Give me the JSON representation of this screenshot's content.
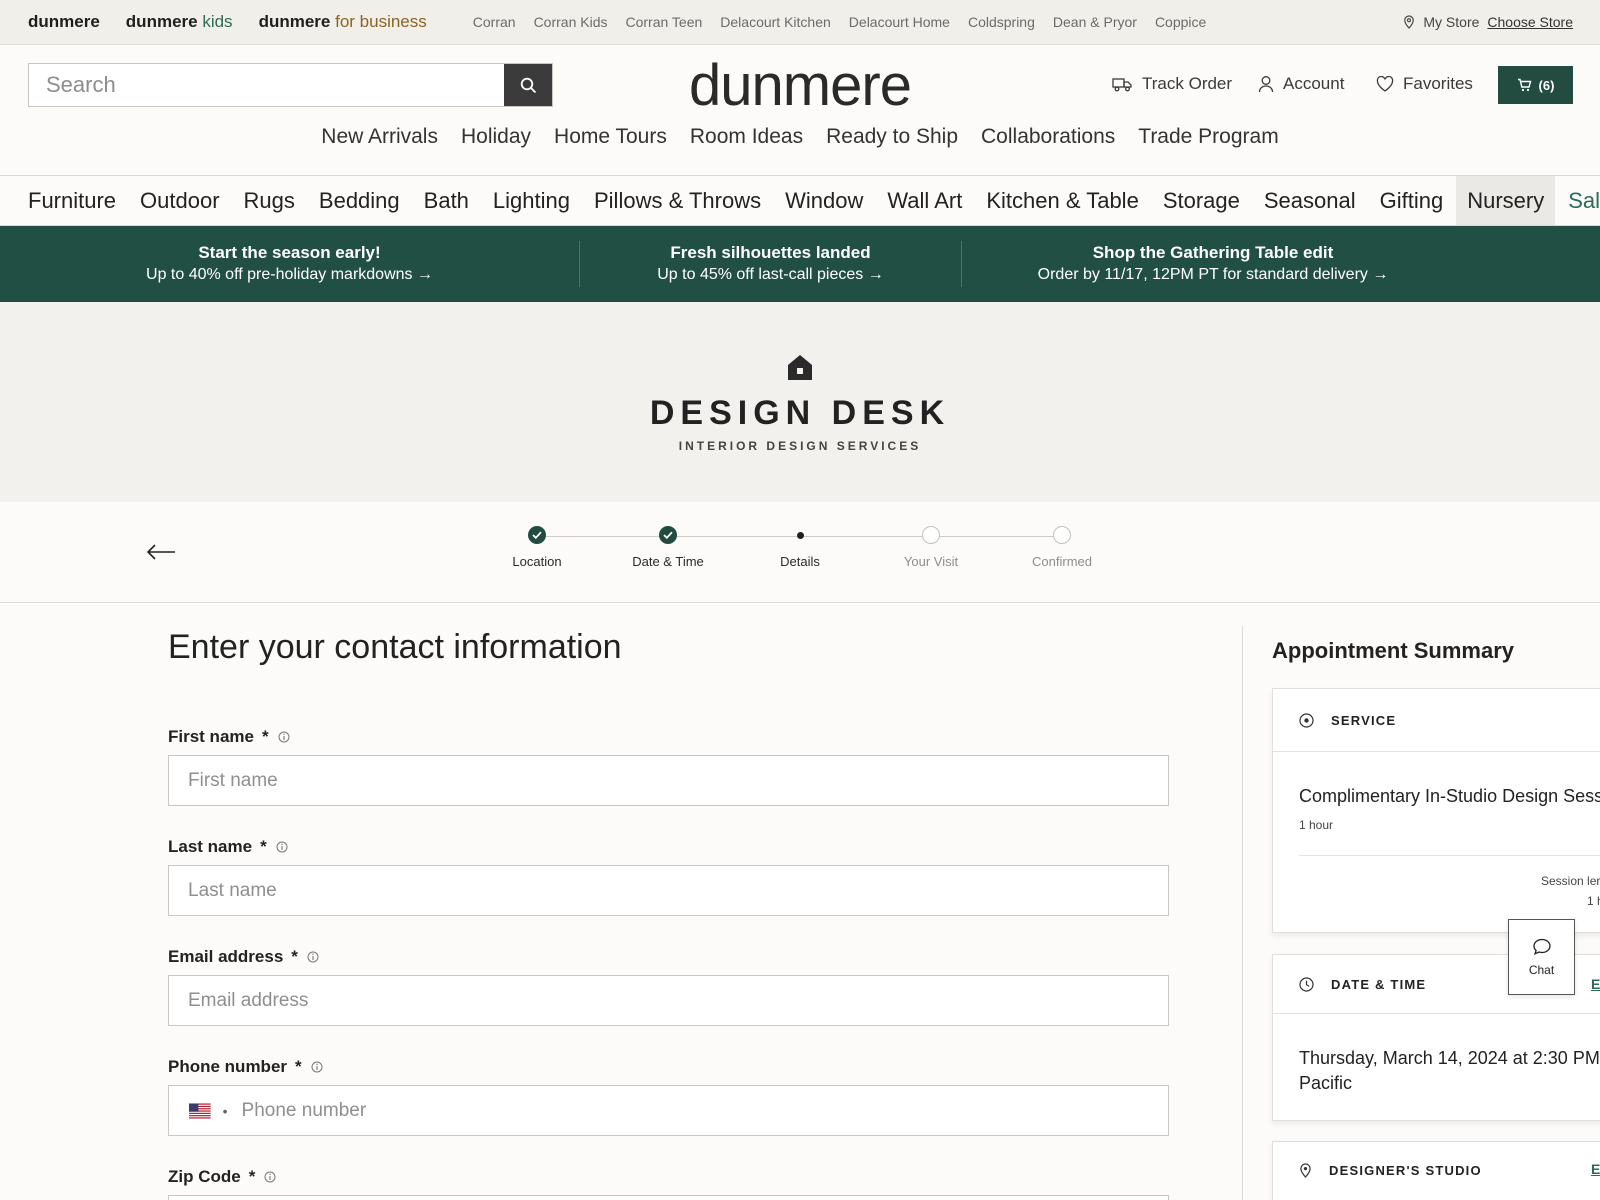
{
  "brands": {
    "main": "dunmere",
    "kids_prefix": "dunmere",
    "kids_suffix": "kids",
    "biz_prefix": "dunmere",
    "biz_suffix": "for business"
  },
  "sister_brands": [
    "Corran",
    "Corran Kids",
    "Corran Teen",
    "Delacourt Kitchen",
    "Delacourt Home",
    "Coldspring",
    "Dean & Pryor",
    "Coppice"
  ],
  "store": {
    "label": "My Store",
    "choose": "Choose Store"
  },
  "search": {
    "placeholder": "Search"
  },
  "logo": "dunmere",
  "header": {
    "track_order": "Track Order",
    "account": "Account",
    "favorites": "Favorites",
    "cart_count": "(6)"
  },
  "subnav": [
    "New Arrivals",
    "Holiday",
    "Home Tours",
    "Room Ideas",
    "Ready to Ship",
    "Collaborations",
    "Trade Program"
  ],
  "categories": [
    "Furniture",
    "Outdoor",
    "Rugs",
    "Bedding",
    "Bath",
    "Lighting",
    "Pillows & Throws",
    "Window",
    "Wall Art",
    "Kitchen & Table",
    "Storage",
    "Seasonal",
    "Gifting",
    "Nursery",
    "Sale"
  ],
  "promos": [
    {
      "title": "Start the season early!",
      "text": "Up to 40% off pre-holiday markdowns →"
    },
    {
      "title": "Fresh silhouettes landed",
      "text": "Up to 45% off last-call pieces →"
    },
    {
      "title": "Shop the Gathering Table edit",
      "text": "Order by 11/17, 12PM PT for standard delivery →"
    }
  ],
  "hero": {
    "title": "DESIGN DESK",
    "subtitle": "INTERIOR DESIGN SERVICES"
  },
  "steps": [
    {
      "label": "Location",
      "state": "done"
    },
    {
      "label": "Date & Time",
      "state": "done"
    },
    {
      "label": "Details",
      "state": "current"
    },
    {
      "label": "Your Visit",
      "state": "todo"
    },
    {
      "label": "Confirmed",
      "state": "todo"
    }
  ],
  "form": {
    "title": "Enter your contact information",
    "required_mark": "*",
    "first_name": {
      "label": "First name",
      "placeholder": "First name",
      "value": ""
    },
    "last_name": {
      "label": "Last name",
      "placeholder": "Last name",
      "value": ""
    },
    "email": {
      "label": "Email address",
      "placeholder": "Email address",
      "value": ""
    },
    "phone": {
      "label": "Phone number",
      "placeholder": "Phone number",
      "value": "",
      "country_separator": "•"
    },
    "zip": {
      "label": "Zip Code"
    }
  },
  "summary": {
    "title": "Appointment Summary",
    "service": {
      "heading": "SERVICE",
      "name": "Complimentary In-Studio Design Sessi",
      "duration": "1 hour",
      "session_label": "Session ler",
      "session_value": "1 h"
    },
    "datetime": {
      "heading": "DATE & TIME",
      "edit": "E",
      "line1": "Thursday, March 14, 2024 at 2:30 PM",
      "line2": "Pacific"
    },
    "studio": {
      "heading": "DESIGNER'S STUDIO",
      "edit": "E"
    }
  },
  "chat": {
    "label": "Chat"
  },
  "colors": {
    "accent": "#234c40",
    "promo_bg": "#224f44",
    "sale": "#2b6a57"
  }
}
